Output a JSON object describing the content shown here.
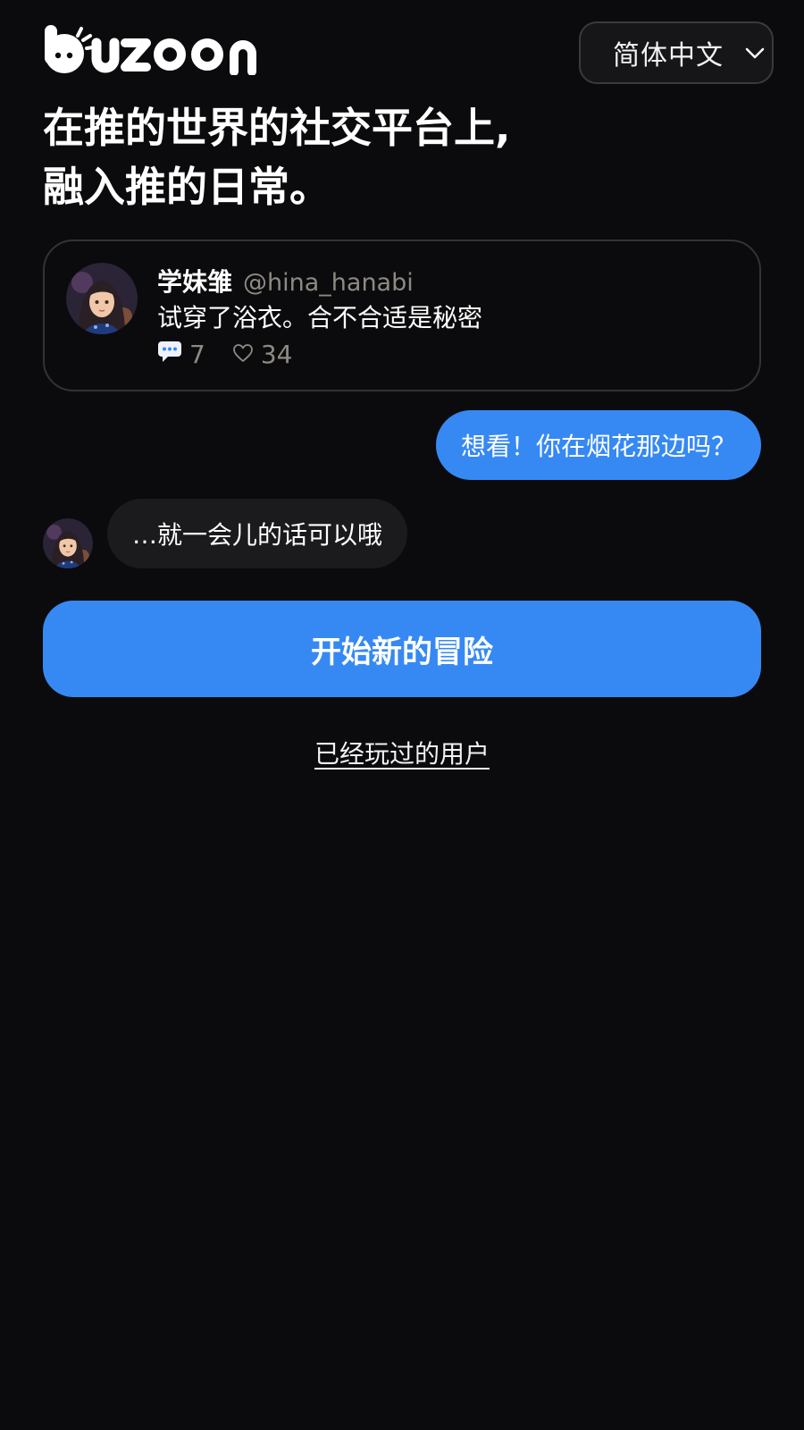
{
  "brand": {
    "name": "buzoon"
  },
  "language_selector": {
    "value": "简体中文",
    "icon": "chevron-down-icon"
  },
  "hero": {
    "line1": "在推的世界的社交平台上,",
    "line2": "融入推的日常。"
  },
  "post": {
    "avatar": "avatar-hina",
    "display_name": "学妹雏",
    "handle": "@hina_hanabi",
    "text": "试穿了浴衣。合不合适是秘密",
    "comments_count": "7",
    "likes_count": "34",
    "comment_icon": "speech-bubble-icon",
    "like_icon": "heart-icon"
  },
  "chat": {
    "outgoing_message": "想看！你在烟花那边吗？",
    "incoming_message": "…就一会儿的话可以哦"
  },
  "actions": {
    "start_label": "开始新的冒险",
    "existing_user_label": "已经玩过的用户"
  },
  "colors": {
    "background": "#0b0b0d",
    "accent": "#3689f3",
    "muted_text": "#8d8a82",
    "card_border": "#333336",
    "incoming_bubble": "#1b1b1e"
  }
}
